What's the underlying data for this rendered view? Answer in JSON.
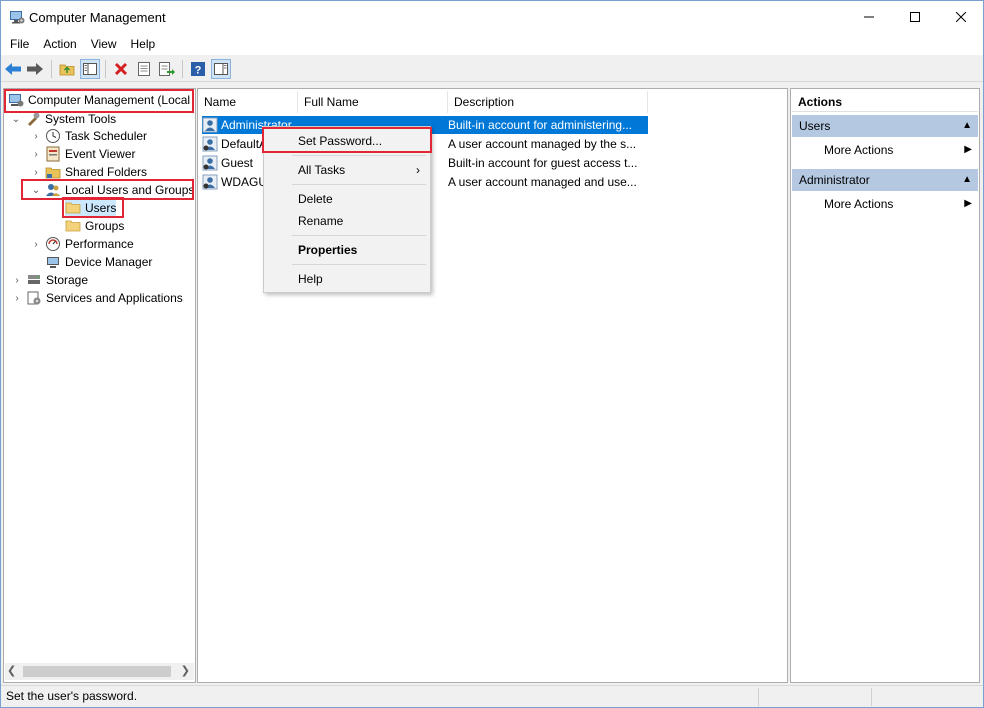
{
  "window": {
    "title": "Computer Management",
    "controls": {
      "minimize": "—",
      "maximize": "☐",
      "close": "✕"
    }
  },
  "menu": [
    "File",
    "Action",
    "View",
    "Help"
  ],
  "toolbar": {
    "icons": [
      "back-arrow-icon",
      "forward-arrow-icon",
      "up-folder-icon",
      "show-hide-tree-icon",
      "delete-icon",
      "properties-icon",
      "export-list-icon",
      "help-icon",
      "show-hide-action-pane-icon"
    ]
  },
  "tree": {
    "root": "Computer Management (Local",
    "system_tools": "System Tools",
    "task_scheduler": "Task Scheduler",
    "event_viewer": "Event Viewer",
    "shared_folders": "Shared Folders",
    "local_users_groups": "Local Users and Groups",
    "users": "Users",
    "groups": "Groups",
    "performance": "Performance",
    "device_manager": "Device Manager",
    "storage": "Storage",
    "services_apps": "Services and Applications"
  },
  "list": {
    "columns": [
      "Name",
      "Full Name",
      "Description"
    ],
    "rows": [
      {
        "name": "Administrator",
        "full_name": "",
        "description": "Built-in account for administering..."
      },
      {
        "name": "DefaultA",
        "full_name": "",
        "description": "A user account managed by the s..."
      },
      {
        "name": "Guest",
        "full_name": "",
        "description": "Built-in account for guest access t..."
      },
      {
        "name": "WDAGU",
        "full_name": "",
        "description": "A user account managed and use..."
      }
    ]
  },
  "context_menu": {
    "set_password": "Set Password...",
    "all_tasks": "All Tasks",
    "delete": "Delete",
    "rename": "Rename",
    "properties": "Properties",
    "help": "Help",
    "submenu_arrow": "›"
  },
  "actions": {
    "header": "Actions",
    "section1": "Users",
    "section1_item": "More Actions",
    "section2": "Administrator",
    "section2_item": "More Actions",
    "collapse_caret": "▲",
    "more_arrow": "▶"
  },
  "statusbar": {
    "text": "Set the user's password."
  },
  "colors": {
    "selection": "#0078d7",
    "highlight_box": "#e32636",
    "section_bg": "#b4c8e1"
  }
}
